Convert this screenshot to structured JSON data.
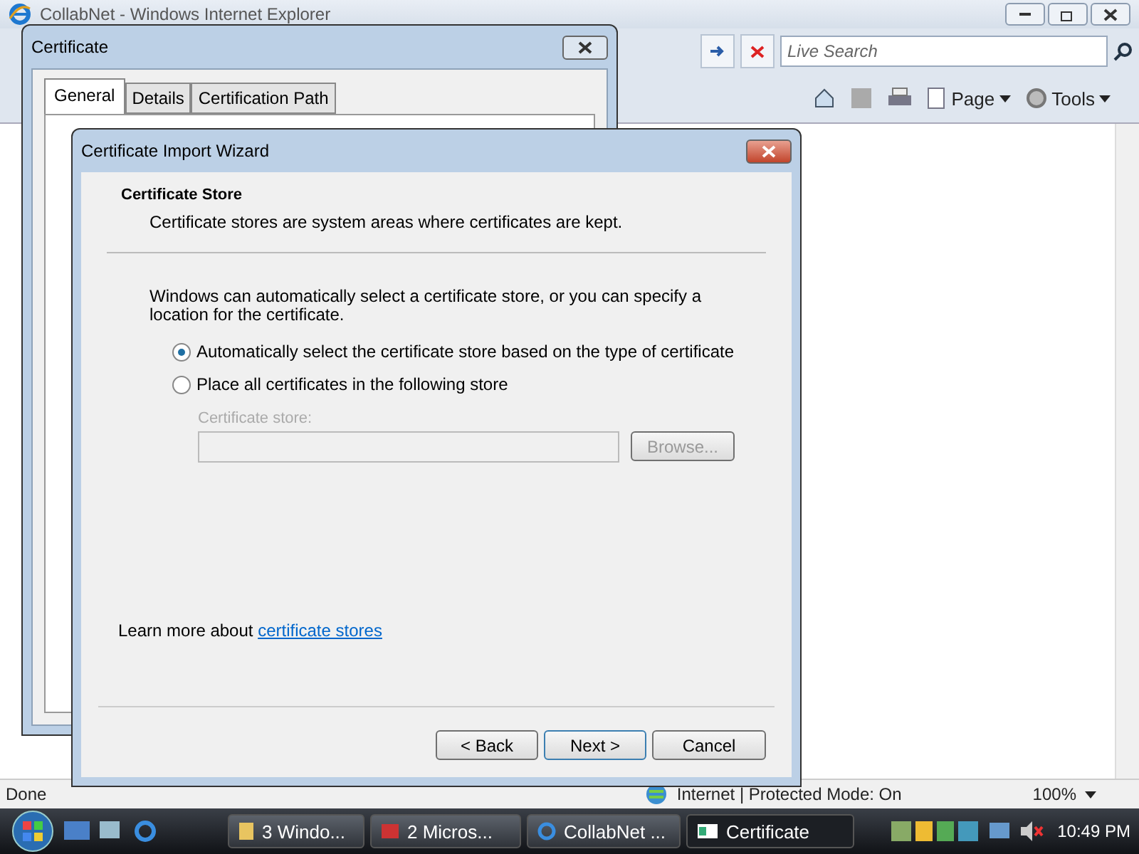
{
  "browser": {
    "title": "CollabNet - Windows Internet Explorer",
    "search": {
      "placeholder": "Live Search"
    },
    "toolbar": [
      "Page",
      "Tools"
    ],
    "status": "Done",
    "zone": "Internet | Protected Mode: On",
    "zoom": "100%"
  },
  "certificate_dialog": {
    "title": "Certificate",
    "tabs": [
      {
        "label": "General",
        "selected": true
      },
      {
        "label": "Details",
        "selected": false
      },
      {
        "label": "Certification Path",
        "selected": false
      }
    ]
  },
  "wizard": {
    "title": "Certificate Import Wizard",
    "heading": "Certificate Store",
    "subheading": "Certificate stores are system areas where certificates are kept.",
    "description": "Windows can automatically select a certificate store, or you can specify a location for the certificate.",
    "options": [
      {
        "label": "Automatically select the certificate store based on the type of certificate",
        "selected": true
      },
      {
        "label": "Place all certificates in the following store",
        "selected": false
      }
    ],
    "store": {
      "label": "Certificate store:",
      "disabled": true,
      "browse": "Browse..."
    },
    "learn_more": {
      "text": "Learn more about",
      "link": "certificate stores"
    },
    "buttons": [
      {
        "label": "< Back",
        "default": false
      },
      {
        "label": "Next >",
        "default": true
      },
      {
        "label": "Cancel",
        "default": false
      }
    ]
  },
  "taskbar": {
    "items": [
      {
        "label": "3 Windo...",
        "kind": "folder",
        "selected": false
      },
      {
        "label": "2 Micros...",
        "kind": "app",
        "selected": false
      },
      {
        "label": "CollabNet ...",
        "kind": "browser",
        "selected": false
      },
      {
        "label": "Certificate",
        "kind": "window",
        "selected": true
      }
    ],
    "clock": "10:49 PM"
  }
}
